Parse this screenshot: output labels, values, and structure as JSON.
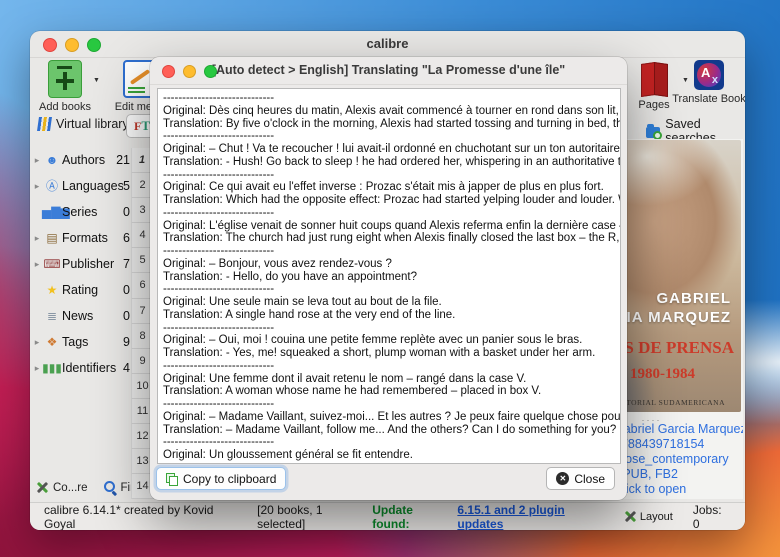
{
  "main_window": {
    "title": "calibre",
    "toolbar": {
      "add_books": "Add books",
      "edit_metadata": "Edit metad",
      "pages": "Pages",
      "translate_book": "Translate Book"
    },
    "filter_row": {
      "virtual_library": "Virtual library",
      "font_button_f": "F",
      "font_button_t": "T",
      "saved_searches": "Saved searches"
    },
    "tag_browser": {
      "items": [
        {
          "label": "Authors",
          "count": "21",
          "arrow": "▸",
          "icon": "authors-icon",
          "glyph": "☻",
          "color": "#3b7dd8"
        },
        {
          "label": "Languages",
          "count": "5",
          "arrow": "▸",
          "icon": "languages-icon",
          "glyph": "Ⓐ",
          "color": "#3b7dd8"
        },
        {
          "label": "Series",
          "count": "0",
          "arrow": "",
          "icon": "series-icon",
          "glyph": "▅▇▆",
          "color": "#3b7dd8"
        },
        {
          "label": "Formats",
          "count": "6",
          "arrow": "▸",
          "icon": "formats-icon",
          "glyph": "▤",
          "color": "#8a6a3a"
        },
        {
          "label": "Publisher",
          "count": "7",
          "arrow": "▸",
          "icon": "publisher-icon",
          "glyph": "⌨",
          "color": "#9a4a4a"
        },
        {
          "label": "Rating",
          "count": "0",
          "arrow": "",
          "icon": "rating-icon",
          "glyph": "★",
          "color": "#f2c11e"
        },
        {
          "label": "News",
          "count": "0",
          "arrow": "",
          "icon": "news-icon",
          "glyph": "≣",
          "color": "#8a97a5"
        },
        {
          "label": "Tags",
          "count": "9",
          "arrow": "▸",
          "icon": "tags-icon",
          "glyph": "❖",
          "color": "#cf7a33"
        },
        {
          "label": "Identifiers",
          "count": "4",
          "arrow": "▸",
          "icon": "identifiers-icon",
          "glyph": "▮▮▮",
          "color": "#4aa050"
        }
      ],
      "configure_label": "Co...re",
      "find_label": "Find"
    },
    "book_list": {
      "row_numbers": [
        {
          "n": "1",
          "current": true
        },
        {
          "n": "2"
        },
        {
          "n": "3"
        },
        {
          "n": "4"
        },
        {
          "n": "5"
        },
        {
          "n": "6"
        },
        {
          "n": "7"
        },
        {
          "n": "8"
        },
        {
          "n": "9"
        },
        {
          "n": "10"
        },
        {
          "n": "11"
        },
        {
          "n": "12"
        },
        {
          "n": "13"
        },
        {
          "n": "14"
        }
      ]
    },
    "book_details": {
      "cover": {
        "author_line1": "GABRIEL",
        "author_line2": "GARCIA MARQUEZ",
        "title": "NOTAS DE PRENSA",
        "years": "1980-1984",
        "publisher": "EDITORIAL SUDAMERICANA"
      },
      "handle_dots": "····",
      "links": [
        "Gabriel Garcia Marquez",
        "9788439718154",
        "prose_contemporary",
        "EPUB, FB2",
        "Click to open"
      ]
    },
    "status_bar": {
      "version_text": "calibre 6.14.1* created by Kovid Goyal",
      "books_text": "[20 books, 1 selected]",
      "update_label": "Update found:",
      "update_link": "6.15.1 and 2 plugin updates",
      "layout_label": "Layout",
      "jobs_text": "Jobs: 0"
    }
  },
  "dialog": {
    "title": "[Auto detect > English] Translating \"La Promesse d'une île\"",
    "lines": [
      "-----------------------------",
      "Original: Dès cinq heures du matin, Alexis avait commencé à tourner en rond dans son lit, en",
      "Translation: By five o'clock in the morning, Alexis had started tossing and turning in bed, thinking",
      "-----------------------------",
      "Original: – Chut ! Va te recoucher ! lui avait-il ordonné en chuchotant sur un ton autoritaire.",
      "Translation: - Hush! Go back to sleep ! he had ordered her, whispering in an authoritative tone.",
      "-----------------------------",
      "Original: Ce qui avait eu l'effet inverse : Prozac s'était mis à japper de plus en plus fort.",
      "Translation: Which had the opposite effect: Prozac had started yelping louder and louder. When",
      "-----------------------------",
      "Original: L'église venait de sonner huit coups quand Alexis referma enfin la dernière case –",
      "Translation: The church had just rung eight when Alexis finally closed the last box – the R, for de",
      "-----------------------------",
      "Original: – Bonjour, vous avez rendez-vous ?",
      "Translation: - Hello, do you have an appointment?",
      "-----------------------------",
      "Original: Une seule main se leva tout au bout de la file.",
      "Translation: A single hand rose at the very end of the line.",
      "-----------------------------",
      "Original: – Oui, moi ! couina une petite femme replète avec un panier sous le bras.",
      "Translation: - Yes, me! squeaked a short, plump woman with a basket under her arm.",
      "-----------------------------",
      "Original: Une femme dont il avait retenu le nom – rangé dans la case V.",
      "Translation: A woman whose name he had remembered – placed in box V.",
      "-----------------------------",
      "Original: – Madame Vaillant, suivez-moi... Et les autres ? Je peux faire quelque chose pour vous ?",
      "Translation: – Madame Vaillant, follow me... And the others? Can I do something for you?",
      "-----------------------------",
      "Original: Un gloussement général se fit entendre."
    ],
    "copy_button": "Copy to clipboard",
    "close_button": "Close"
  }
}
